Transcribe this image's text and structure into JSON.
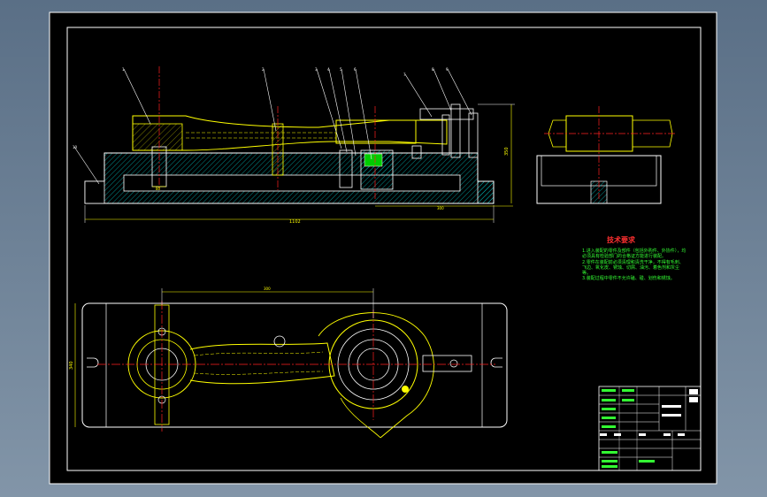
{
  "drawing": {
    "dim_overall_length": "1102",
    "dim_height_right": "350",
    "dim_height_plan": "340",
    "dim_small_bottom": "300",
    "dim_small_left": "80",
    "dim_top_plan": "300"
  },
  "callouts": [
    "1",
    "2",
    "3",
    "4",
    "5",
    "6",
    "7",
    "8",
    "9",
    "10"
  ],
  "tech_requirements": {
    "title": "技术要求",
    "notes": [
      "1.进入装配的零件及部件（包括外购件、外协件），均必须具有检验部门的合格证方能进行装配。",
      "2.零件在装配前必须清理和清洗干净，不得有毛刺、飞边、氧化皮、锈蚀、切屑、油污、着色剂和灰尘等。",
      "3.装配过程中零件不允许磕、碰、划伤和锈蚀。"
    ]
  },
  "title_block": {
    "row_labels": [
      "标记",
      "处数",
      "分区",
      "更改文件号",
      "签名",
      "年月日"
    ],
    "bottom": [
      "设计",
      "标准化",
      "审核",
      "工艺",
      "批准"
    ]
  },
  "colors": {
    "background_gradient": [
      "#5a6f86",
      "#8295a8"
    ],
    "sheet": "#000000",
    "outline": "#ffffff",
    "part_yellow": "#ffff00",
    "hatch_cyan": "#00cccc",
    "center_red": "#ff2020",
    "text_green": "#33ff33",
    "dim_yellow": "#ffff00"
  }
}
